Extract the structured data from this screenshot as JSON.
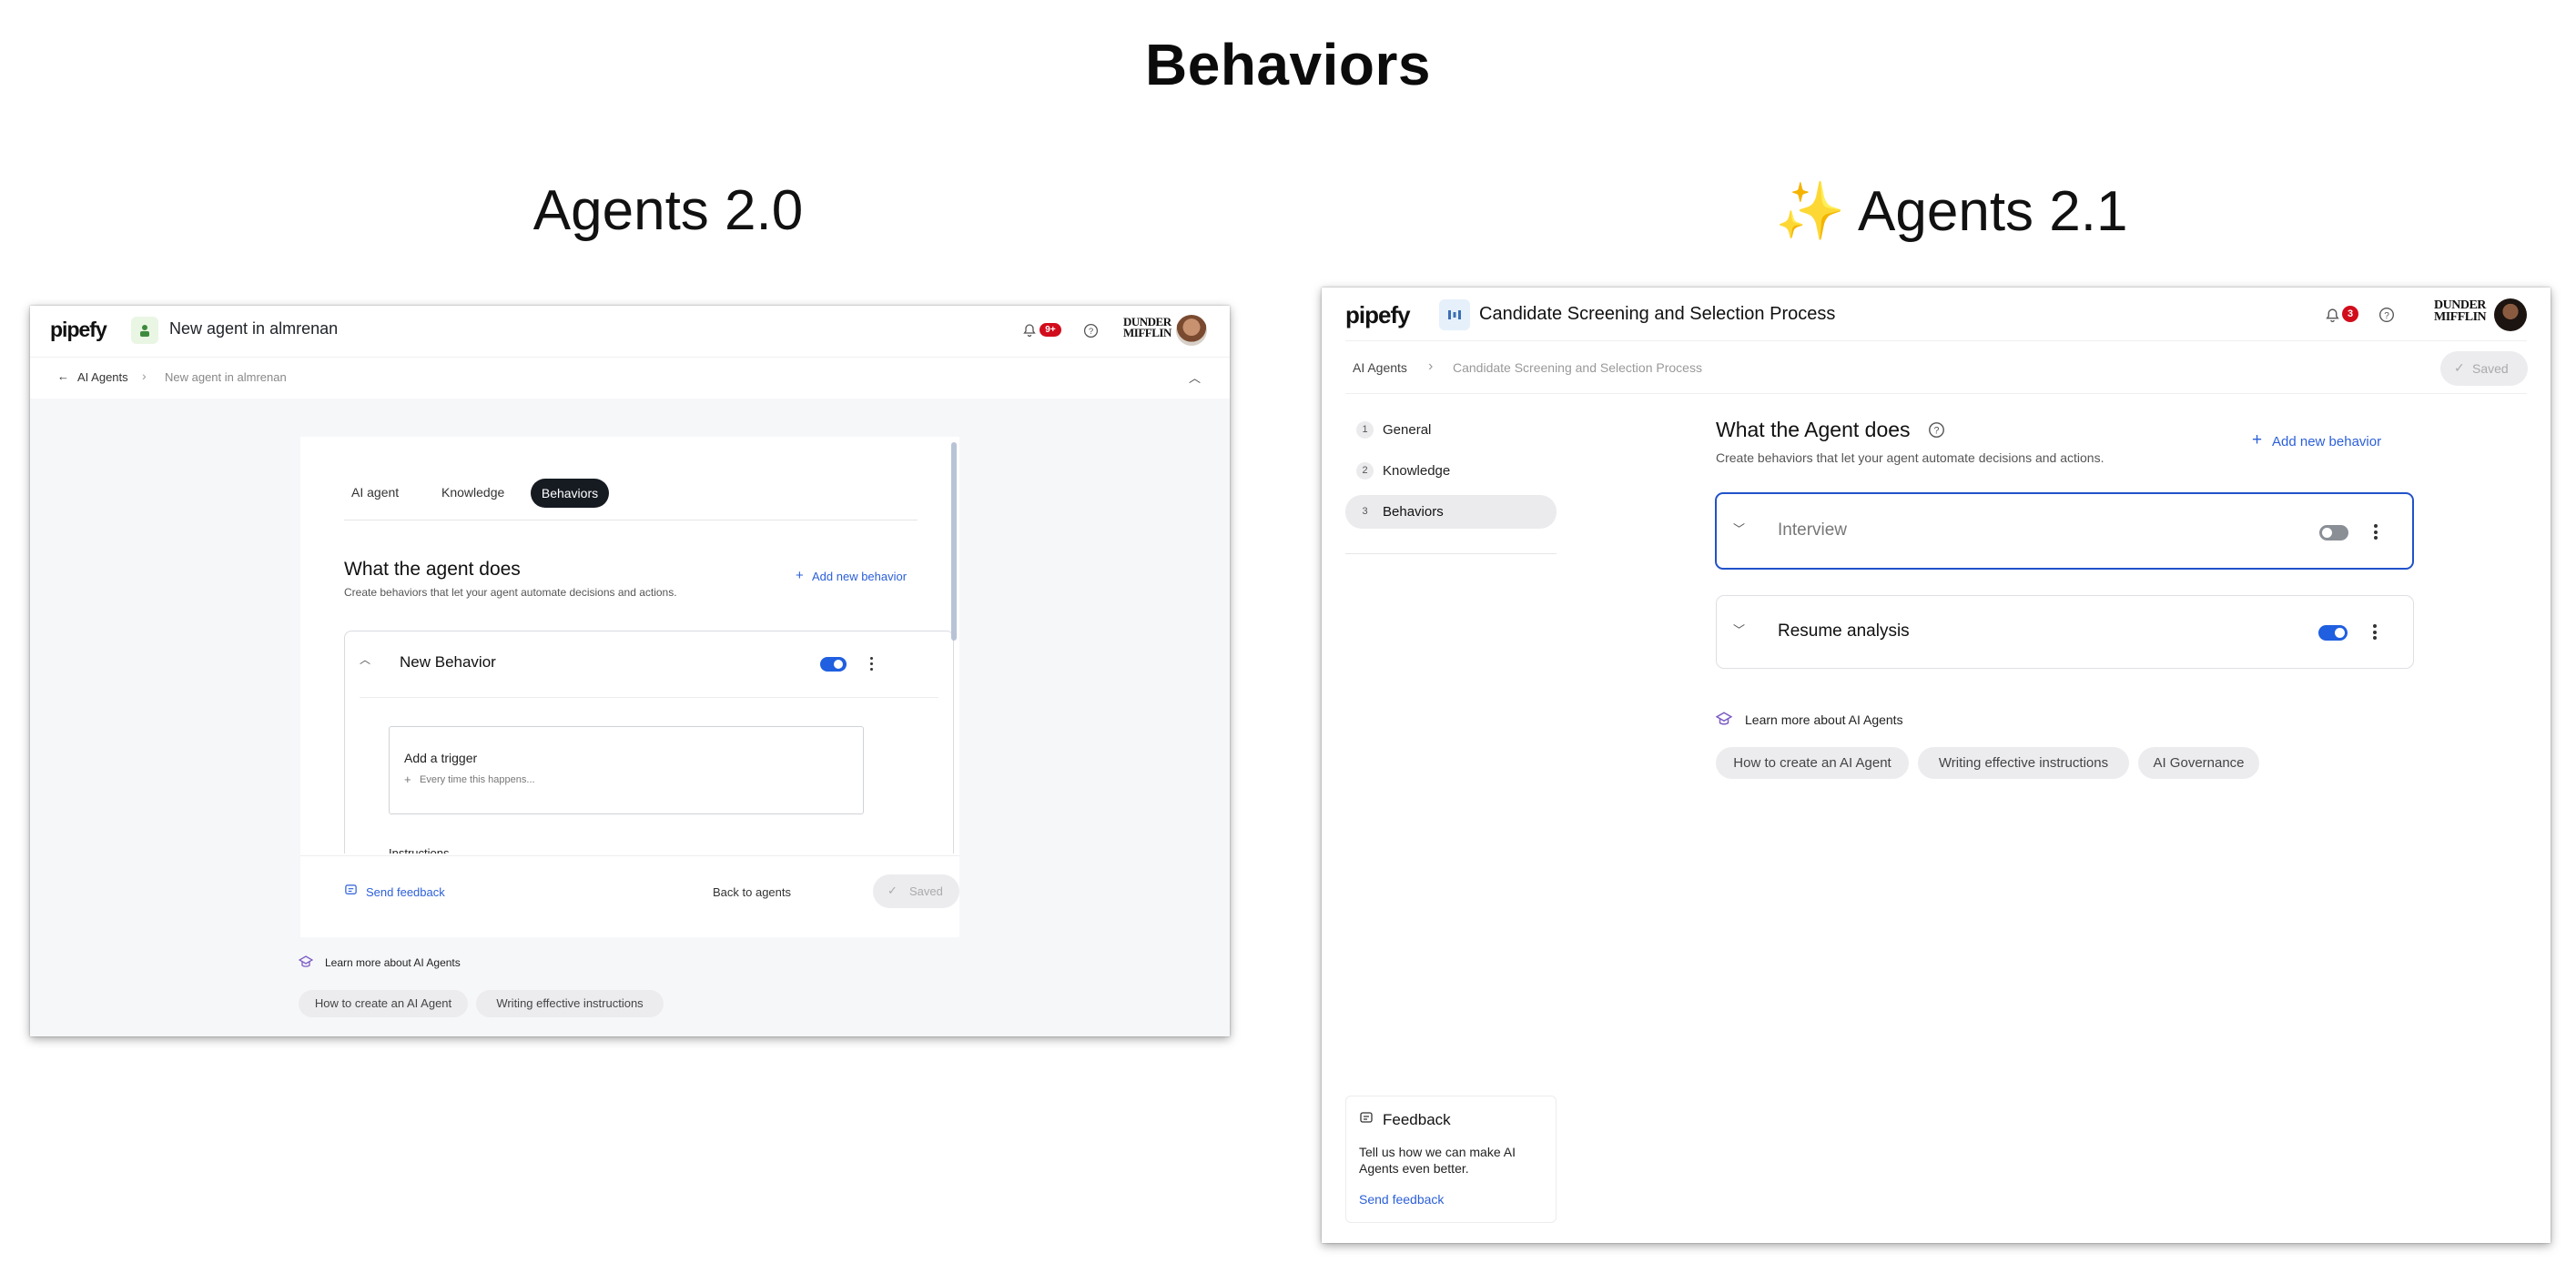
{
  "page": {
    "title": "Behaviors"
  },
  "left": {
    "heading": "Agents 2.0",
    "app": {
      "logo": "pipefy",
      "title": "New agent in almrenan",
      "notif_count": "9+",
      "company_logo": "DUNDER MIFFLIN"
    },
    "breadcrumb": {
      "back": "AI Agents",
      "current": "New agent in almrenan"
    },
    "tabs": [
      {
        "label": "AI agent"
      },
      {
        "label": "Knowledge"
      },
      {
        "label": "Behaviors"
      }
    ],
    "section": {
      "title": "What the agent does",
      "subtitle": "Create behaviors that let your agent automate decisions and actions.",
      "add_label": "Add new behavior"
    },
    "behavior": {
      "name": "New Behavior",
      "enabled": true
    },
    "trigger": {
      "title": "Add a trigger",
      "placeholder": "Every time this happens..."
    },
    "instructions_label": "Instructions",
    "footer": {
      "feedback": "Send feedback",
      "back": "Back to agents",
      "saved": "Saved"
    },
    "learn": {
      "title": "Learn more about AI Agents",
      "links": [
        "How to create an AI Agent",
        "Writing effective instructions"
      ]
    }
  },
  "right": {
    "heading_icon": "✨",
    "heading": "Agents 2.1",
    "app": {
      "logo": "pipefy",
      "title": "Candidate Screening and Selection Process",
      "notif_count": "3",
      "company_logo": "DUNDER MIFFLIN"
    },
    "breadcrumb": {
      "root": "AI Agents",
      "current": "Candidate Screening and Selection Process",
      "saved": "Saved"
    },
    "steps": [
      {
        "num": "1",
        "label": "General"
      },
      {
        "num": "2",
        "label": "Knowledge"
      },
      {
        "num": "3",
        "label": "Behaviors"
      }
    ],
    "section": {
      "title": "What the Agent does",
      "subtitle": "Create behaviors that let your agent automate decisions and actions.",
      "add_label": "Add new behavior"
    },
    "behaviors": [
      {
        "name": "Interview",
        "enabled": false
      },
      {
        "name": "Resume analysis",
        "enabled": true
      }
    ],
    "learn": {
      "title": "Learn more about AI Agents",
      "links": [
        "How to create an AI Agent",
        "Writing effective instructions",
        "AI Governance"
      ]
    },
    "feedback": {
      "title": "Feedback",
      "text": "Tell us how we can make AI Agents even better.",
      "link": "Send feedback"
    }
  },
  "colors": {
    "accent": "#2b5fd9",
    "toggle_on": "#1f5fe0",
    "toggle_off": "#8a8f96",
    "badge": "#d10d1c",
    "focus_border": "#2152c9"
  }
}
